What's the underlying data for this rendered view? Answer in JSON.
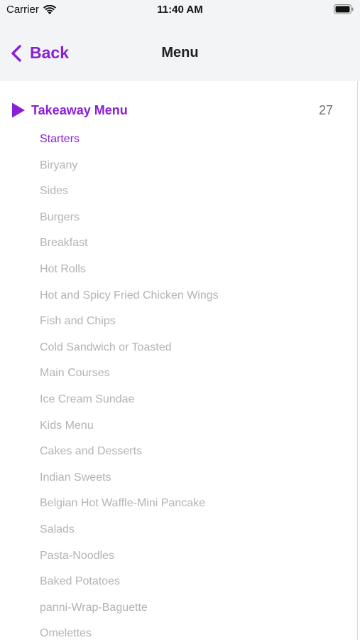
{
  "status_bar": {
    "carrier": "Carrier",
    "time": "11:40 AM"
  },
  "nav": {
    "back_label": "Back",
    "title": "Menu"
  },
  "section": {
    "title": "Takeaway Menu",
    "count": "27"
  },
  "categories": [
    "Starters",
    "Biryany",
    "Sides",
    "Burgers",
    "Breakfast",
    "Hot Rolls",
    "Hot and Spicy Fried Chicken Wings",
    "Fish and Chips",
    "Cold Sandwich or Toasted",
    "Main Courses",
    "Ice Cream Sundae",
    "Kids Menu",
    "Cakes and Desserts",
    "Indian Sweets",
    "Belgian Hot Waffle-Mini Pancake",
    "Salads",
    "Pasta-Noodles",
    "Baked Potatoes",
    "panni-Wrap-Baguette",
    "Omelettes"
  ],
  "selected_category_index": 0,
  "colors": {
    "accent": "#8a1fd6",
    "inactive_text": "#b3b3b3",
    "bar_background": "#f3f4f6"
  }
}
